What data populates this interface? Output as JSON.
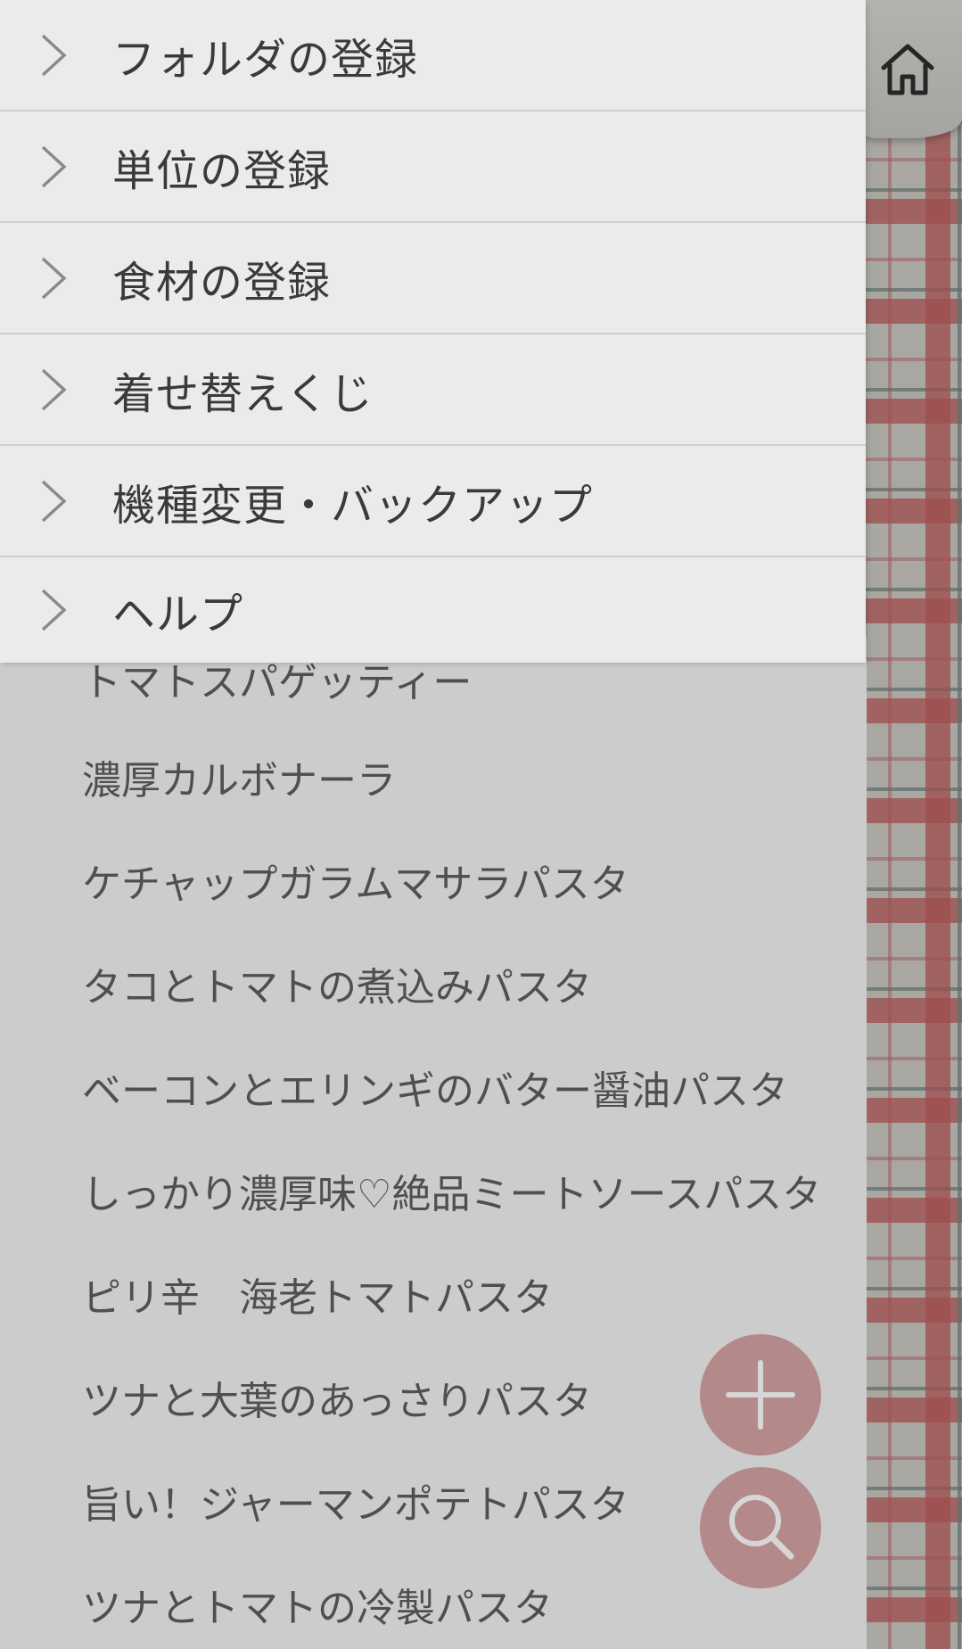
{
  "drawer": {
    "items": [
      {
        "label": "フォルダの登録"
      },
      {
        "label": "単位の登録"
      },
      {
        "label": "食材の登録"
      },
      {
        "label": "着せ替えくじ"
      },
      {
        "label": "機種変更・バックアップ"
      },
      {
        "label": "ヘルプ"
      }
    ]
  },
  "recipes": [
    "トマトスパゲッティー",
    "濃厚カルボナーラ",
    "ケチャップガラムマサラパスタ",
    "タコとトマトの煮込みパスタ",
    "ベーコンとエリンギのバター醤油パスタ",
    "しっかり濃厚味♡絶品ミートソースパスタ",
    "ピリ辛　海老トマトパスタ",
    "ツナと大葉のあっさりパスタ",
    "旨い！ジャーマンポテトパスタ",
    "ツナとトマトの冷製パスタ"
  ],
  "icons": {
    "home": "home-icon",
    "chevron": "chevron-right-icon",
    "add": "plus-icon",
    "search": "search-icon"
  },
  "colors": {
    "drawer_bg": "#ebebeb",
    "plaid_red": "#bc5c5c",
    "plaid_base": "#c9c7c1",
    "fab": "#d6a4a4"
  }
}
